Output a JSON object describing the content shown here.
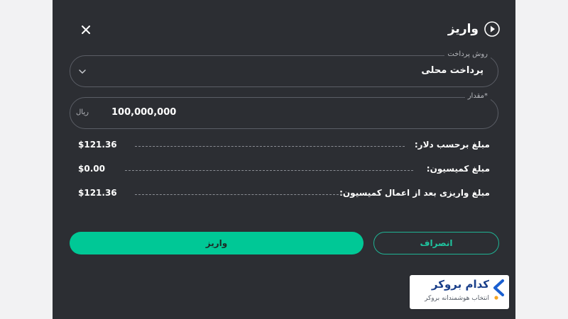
{
  "dialog": {
    "title": "واریز",
    "close_symbol": "✕",
    "icons": {
      "title": "play-circle-icon",
      "close": "close-icon",
      "dropdown": "chevron-down-icon"
    }
  },
  "form": {
    "payment_method": {
      "label": "روش پرداخت",
      "value": "پرداخت محلی"
    },
    "amount": {
      "label": "*مقدار",
      "value": "100,000,000",
      "unit": "ریال"
    }
  },
  "summary": [
    {
      "label": "مبلغ برحسب دلار:",
      "value": "$121.36"
    },
    {
      "label": "مبلغ کمیسیون:",
      "value": "$0.00"
    },
    {
      "label": "مبلغ واریزی بعد از اعمال کمیسیون:",
      "value": "$121.36"
    }
  ],
  "actions": {
    "cancel_label": "انصراف",
    "deposit_label": "واریز"
  },
  "watermark": {
    "title": "کدام بروکر",
    "subtitle": "انتخاب هوشمندانه بروکر"
  },
  "colors": {
    "dialog_bg": "#2c2e33",
    "accent": "#00c896",
    "field_border": "#5b5e66",
    "brand_blue": "#1a3f8a",
    "brand_dot": "#f5a623"
  }
}
